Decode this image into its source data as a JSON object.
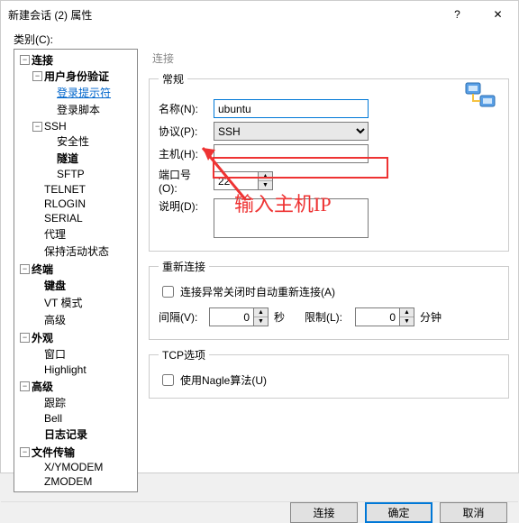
{
  "window": {
    "title": "新建会话 (2) 属性",
    "help": "?",
    "close": "✕"
  },
  "category_label": "类别(C):",
  "tree": {
    "conn": "连接",
    "auth": "用户身份验证",
    "loginprompt": "登录提示符",
    "loginscript": "登录脚本",
    "ssh": "SSH",
    "security": "安全性",
    "tunnel": "隧道",
    "sftp": "SFTP",
    "telnet": "TELNET",
    "rlogin": "RLOGIN",
    "serial": "SERIAL",
    "proxy": "代理",
    "keepalive": "保持活动状态",
    "terminal": "终端",
    "keyboard": "键盘",
    "vtmode": "VT 模式",
    "advanced1": "高级",
    "appearance": "外观",
    "window": "窗口",
    "highlight": "Highlight",
    "advanced2": "高级",
    "trace": "跟踪",
    "bell": "Bell",
    "logging": "日志记录",
    "filetrans": "文件传输",
    "xymodem": "X/YMODEM",
    "zmodem": "ZMODEM"
  },
  "right_heading": "连接",
  "general": {
    "legend": "常规",
    "name_label": "名称(N):",
    "name_value": "ubuntu",
    "proto_label": "协议(P):",
    "proto_value": "SSH",
    "host_label": "主机(H):",
    "host_value": "",
    "port_label": "端口号(O):",
    "port_value": "22",
    "desc_label": "说明(D):",
    "desc_value": ""
  },
  "reconnect": {
    "legend": "重新连接",
    "auto_label": "连接异常关闭时自动重新连接(A)",
    "interval_label": "间隔(V):",
    "interval_value": "0",
    "interval_unit": "秒",
    "limit_label": "限制(L):",
    "limit_value": "0",
    "limit_unit": "分钟"
  },
  "tcp": {
    "legend": "TCP选项",
    "nagle_label": "使用Nagle算法(U)"
  },
  "annotation": "输入主机IP",
  "footer": {
    "connect": "连接",
    "ok": "确定",
    "cancel": "取消"
  }
}
